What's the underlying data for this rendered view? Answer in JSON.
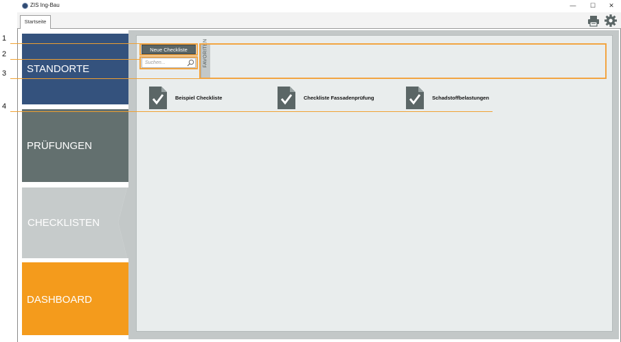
{
  "window": {
    "title": "ZIS Ing-Bau",
    "minimize": "—",
    "maximize": "☐",
    "close": "✕"
  },
  "tabs": [
    {
      "label": "Startseite"
    }
  ],
  "toolbar": {
    "print_icon": "printer-icon",
    "settings_icon": "gear-icon"
  },
  "nav": [
    {
      "label": "STANDORTE",
      "color": "#34527d"
    },
    {
      "label": "PRÜFUNGEN",
      "color": "#63706f"
    },
    {
      "label": "CHECKLISTEN",
      "color": "#c6cbcb",
      "active": true
    },
    {
      "label": "DASHBOARD",
      "color": "#f49b1c"
    }
  ],
  "actions": {
    "new_checklist_label": "Neue Checkliste",
    "search_placeholder": "Suchen...",
    "favorites_label": "FAVORITEN"
  },
  "checklists": [
    {
      "label": "Beispiel Checkliste",
      "icon": "checklist-document-icon"
    },
    {
      "label": "Checkliste Fassadenprüfung",
      "icon": "checklist-document-icon"
    },
    {
      "label": "Schadstoffbelastungen",
      "icon": "checklist-document-icon"
    }
  ],
  "callouts": [
    "1",
    "2",
    "3",
    "4"
  ],
  "colors": {
    "highlight": "#f2a440",
    "content_bg": "#e9eded"
  }
}
